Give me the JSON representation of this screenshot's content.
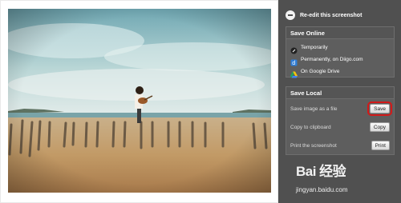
{
  "panel": {
    "reedit_label": "Re-edit this screenshot",
    "save_online": {
      "title": "Save Online",
      "options": [
        {
          "label": "Temporarily",
          "icon": "link-icon"
        },
        {
          "label": "Permanently, on Diigo.com",
          "icon": "diigo-icon"
        },
        {
          "label": "On Google Drive",
          "icon": "google-drive-icon"
        }
      ]
    },
    "save_local": {
      "title": "Save Local",
      "rows": [
        {
          "label": "Save image as a file",
          "button": "Save"
        },
        {
          "label": "Copy to clipboard",
          "button": "Copy"
        },
        {
          "label": "Print the screenshot",
          "button": "Print"
        }
      ]
    }
  },
  "watermark": {
    "brand": "Bai 经验",
    "url": "jingyan.baidu.com"
  },
  "colors": {
    "panel_bg": "#505050",
    "highlight": "#d31919",
    "sky": "#7fb4be",
    "sand": "#c9a06b"
  }
}
